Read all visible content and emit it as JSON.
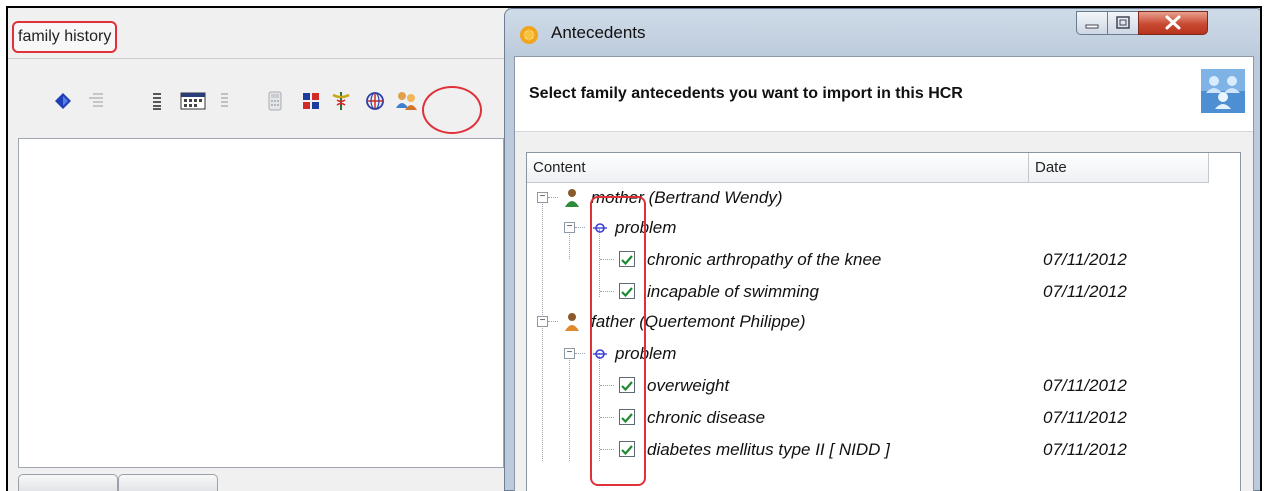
{
  "left_panel": {
    "title": "family history",
    "toolbar_icons": [
      "diamond-icon",
      "list-indent-icon",
      "list-icon",
      "calendar-icon",
      "list-light-icon",
      "calculator-icon",
      "grid-icon",
      "caduceus-icon",
      "globe-icon",
      "family-icon"
    ]
  },
  "dialog": {
    "title": "Antecedents",
    "heading": "Select family antecedents you want to import in this HCR",
    "columns": {
      "content": "Content",
      "date": "Date"
    },
    "tree": {
      "mother": {
        "label": "mother (Bertrand Wendy)",
        "group": "problem",
        "items": [
          {
            "label": "chronic arthropathy of the knee",
            "date": "07/11/2012",
            "checked": true
          },
          {
            "label": "incapable of swimming",
            "date": "07/11/2012",
            "checked": true
          }
        ]
      },
      "father": {
        "label": "father (Quertemont Philippe)",
        "group": "problem",
        "items": [
          {
            "label": "overweight",
            "date": "07/11/2012",
            "checked": true
          },
          {
            "label": "chronic disease",
            "date": "07/11/2012",
            "checked": true
          },
          {
            "label": "diabetes mellitus type II [ NIDD ]",
            "date": "07/11/2012",
            "checked": true
          }
        ]
      }
    }
  },
  "colors": {
    "highlight": "#e0303a",
    "check": "#1f8a2e",
    "titlebar": "#c3d1e1"
  }
}
